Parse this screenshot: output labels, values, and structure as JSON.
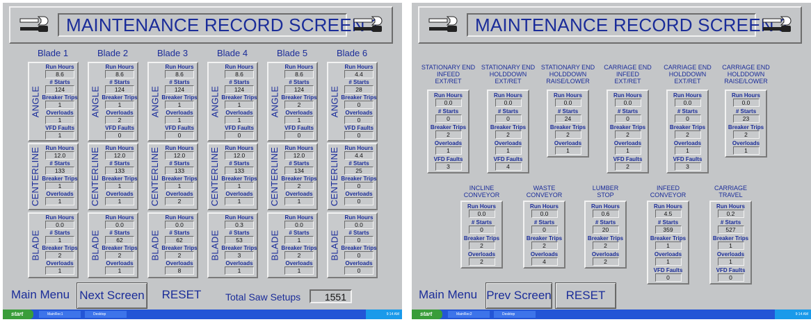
{
  "screen1": {
    "title": "MAINTENANCE RECORD SCREEN 1",
    "blades": [
      "Blade 1",
      "Blade 2",
      "Blade 3",
      "Blade 4",
      "Blade 5",
      "Blade 6"
    ],
    "labels": {
      "run_hours": "Run Hours",
      "starts": "# Starts",
      "breaker_trips": "Breaker Trips",
      "overloads": "Overloads",
      "vfd_faults": "VFD Faults"
    },
    "groups": [
      {
        "name": "ANGLE",
        "rows": [
          {
            "run_hours": "8.6",
            "starts": "124",
            "breaker_trips": "1",
            "overloads": "1",
            "vfd_faults": "1"
          },
          {
            "run_hours": "8.6",
            "starts": "124",
            "breaker_trips": "1",
            "overloads": "2",
            "vfd_faults": "0"
          },
          {
            "run_hours": "8.6",
            "starts": "124",
            "breaker_trips": "1",
            "overloads": "1",
            "vfd_faults": "0"
          },
          {
            "run_hours": "8.6",
            "starts": "124",
            "breaker_trips": "1",
            "overloads": "1",
            "vfd_faults": "0"
          },
          {
            "run_hours": "8.6",
            "starts": "124",
            "breaker_trips": "2",
            "overloads": "1",
            "vfd_faults": "0"
          },
          {
            "run_hours": "4.4",
            "starts": "28",
            "breaker_trips": "0",
            "overloads": "0",
            "vfd_faults": "0"
          }
        ]
      },
      {
        "name": "CENTERLINE",
        "rows": [
          {
            "run_hours": "12.0",
            "starts": "133",
            "breaker_trips": "1",
            "overloads": "1"
          },
          {
            "run_hours": "12.0",
            "starts": "133",
            "breaker_trips": "1",
            "overloads": "1"
          },
          {
            "run_hours": "12.0",
            "starts": "133",
            "breaker_trips": "1",
            "overloads": "2"
          },
          {
            "run_hours": "12.0",
            "starts": "133",
            "breaker_trips": "1",
            "overloads": "1"
          },
          {
            "run_hours": "12.0",
            "starts": "134",
            "breaker_trips": "2",
            "overloads": "1"
          },
          {
            "run_hours": "4.4",
            "starts": "25",
            "breaker_trips": "0",
            "overloads": "0"
          }
        ]
      },
      {
        "name": "BLADE",
        "rows": [
          {
            "run_hours": "0.0",
            "starts": "1",
            "breaker_trips": "2",
            "overloads": "1"
          },
          {
            "run_hours": "0.0",
            "starts": "62",
            "breaker_trips": "2",
            "overloads": "1"
          },
          {
            "run_hours": "0.0",
            "starts": "62",
            "breaker_trips": "2",
            "overloads": "8"
          },
          {
            "run_hours": "0.3",
            "starts": "53",
            "breaker_trips": "3",
            "overloads": "1"
          },
          {
            "run_hours": "0.0",
            "starts": "1",
            "breaker_trips": "2",
            "overloads": "1"
          },
          {
            "run_hours": "0.0",
            "starts": "0",
            "breaker_trips": "0",
            "overloads": "0"
          }
        ]
      }
    ],
    "buttons": {
      "main_menu": "Main Menu",
      "next_screen": "Next Screen",
      "reset": "RESET"
    },
    "total_label": "Total Saw Setups",
    "total_value": "1551",
    "taskbar": {
      "start": "start",
      "task1": "MainRec1",
      "task2": "Desktop",
      "clock": "9:14 AM"
    }
  },
  "screen2": {
    "title": "MAINTENANCE RECORD SCREEN 2",
    "labels": {
      "run_hours": "Run Hours",
      "starts": "# Starts",
      "breaker_trips": "Breaker Trips",
      "overloads": "Overloads",
      "vfd_faults": "VFD Faults"
    },
    "top_groups": [
      {
        "heading": [
          "STATIONARY END",
          "INFEED",
          "EXT/RET"
        ],
        "run_hours": "0.0",
        "starts": "0",
        "breaker_trips": "2",
        "overloads": "1",
        "vfd_faults": "3"
      },
      {
        "heading": [
          "STATIONARY END",
          "HOLDDOWN",
          "EXT/RET"
        ],
        "run_hours": "0.0",
        "starts": "0",
        "breaker_trips": "2",
        "overloads": "1",
        "vfd_faults": "4"
      },
      {
        "heading": [
          "STATIONARY END",
          "HOLDDOWN",
          "RAISE/LOWER"
        ],
        "run_hours": "0.0",
        "starts": "24",
        "breaker_trips": "2",
        "overloads": "1"
      },
      {
        "heading": [
          "CARRIAGE END",
          "INFEED",
          "EXT/RET"
        ],
        "run_hours": "0.0",
        "starts": "0",
        "breaker_trips": "2",
        "overloads": "1",
        "vfd_faults": "2"
      },
      {
        "heading": [
          "CARRIAGE END",
          "HOLDDOWN",
          "EXT/RET"
        ],
        "run_hours": "0.0",
        "starts": "0",
        "breaker_trips": "2",
        "overloads": "1",
        "vfd_faults": "3"
      },
      {
        "heading": [
          "CARRIAGE END",
          "HOLDDOWN",
          "RAISE/LOWER"
        ],
        "run_hours": "0.0",
        "starts": "23",
        "breaker_trips": "2",
        "overloads": "1"
      }
    ],
    "bottom_groups": [
      {
        "heading": [
          "INCLINE",
          "CONVEYOR"
        ],
        "run_hours": "0.0",
        "starts": "0",
        "breaker_trips": "2",
        "overloads": "2"
      },
      {
        "heading": [
          "WASTE",
          "CONVEYOR"
        ],
        "run_hours": "0.0",
        "starts": "0",
        "breaker_trips": "2",
        "overloads": "4"
      },
      {
        "heading": [
          "LUMBER",
          "STOP"
        ],
        "run_hours": "0.6",
        "starts": "20",
        "breaker_trips": "2",
        "overloads": "2"
      },
      {
        "heading": [
          "INFEED",
          "CONVEYOR"
        ],
        "run_hours": "4.5",
        "starts": "359",
        "breaker_trips": "1",
        "overloads": "1",
        "vfd_faults": "0"
      },
      {
        "heading": [
          "CARRIAGE",
          "TRAVEL"
        ],
        "run_hours": "0.2",
        "starts": "527",
        "breaker_trips": "1",
        "overloads": "1",
        "vfd_faults": "0"
      }
    ],
    "buttons": {
      "main_menu": "Main Menu",
      "prev_screen": "Prev Screen",
      "reset": "RESET"
    },
    "taskbar": {
      "start": "start",
      "task1": "MainRec2",
      "task2": "Desktop",
      "clock": "9:14 AM"
    }
  }
}
